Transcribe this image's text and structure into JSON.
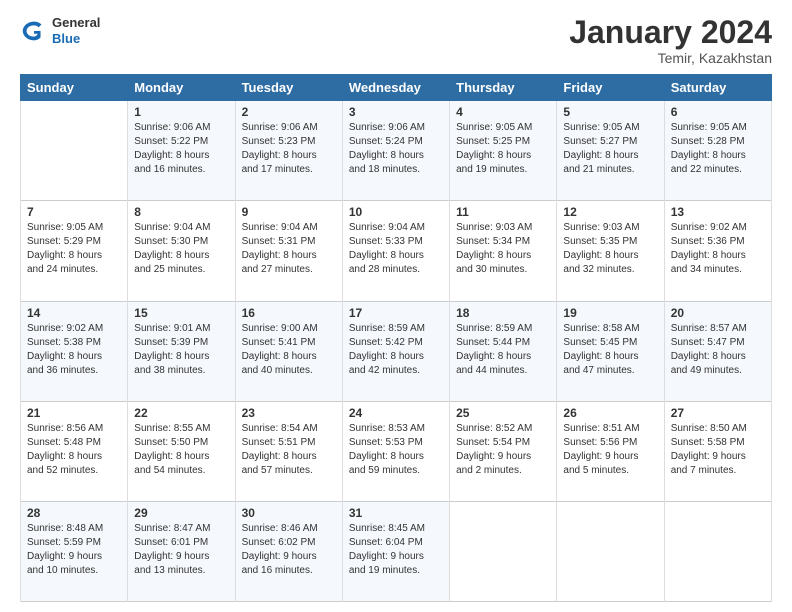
{
  "logo": {
    "general": "General",
    "blue": "Blue"
  },
  "header": {
    "title": "January 2024",
    "subtitle": "Temir, Kazakhstan"
  },
  "columns": [
    "Sunday",
    "Monday",
    "Tuesday",
    "Wednesday",
    "Thursday",
    "Friday",
    "Saturday"
  ],
  "weeks": [
    [
      {
        "day": "",
        "sunrise": "",
        "sunset": "",
        "daylight": ""
      },
      {
        "day": "1",
        "sunrise": "Sunrise: 9:06 AM",
        "sunset": "Sunset: 5:22 PM",
        "daylight": "Daylight: 8 hours and 16 minutes."
      },
      {
        "day": "2",
        "sunrise": "Sunrise: 9:06 AM",
        "sunset": "Sunset: 5:23 PM",
        "daylight": "Daylight: 8 hours and 17 minutes."
      },
      {
        "day": "3",
        "sunrise": "Sunrise: 9:06 AM",
        "sunset": "Sunset: 5:24 PM",
        "daylight": "Daylight: 8 hours and 18 minutes."
      },
      {
        "day": "4",
        "sunrise": "Sunrise: 9:05 AM",
        "sunset": "Sunset: 5:25 PM",
        "daylight": "Daylight: 8 hours and 19 minutes."
      },
      {
        "day": "5",
        "sunrise": "Sunrise: 9:05 AM",
        "sunset": "Sunset: 5:27 PM",
        "daylight": "Daylight: 8 hours and 21 minutes."
      },
      {
        "day": "6",
        "sunrise": "Sunrise: 9:05 AM",
        "sunset": "Sunset: 5:28 PM",
        "daylight": "Daylight: 8 hours and 22 minutes."
      }
    ],
    [
      {
        "day": "7",
        "sunrise": "Sunrise: 9:05 AM",
        "sunset": "Sunset: 5:29 PM",
        "daylight": "Daylight: 8 hours and 24 minutes."
      },
      {
        "day": "8",
        "sunrise": "Sunrise: 9:04 AM",
        "sunset": "Sunset: 5:30 PM",
        "daylight": "Daylight: 8 hours and 25 minutes."
      },
      {
        "day": "9",
        "sunrise": "Sunrise: 9:04 AM",
        "sunset": "Sunset: 5:31 PM",
        "daylight": "Daylight: 8 hours and 27 minutes."
      },
      {
        "day": "10",
        "sunrise": "Sunrise: 9:04 AM",
        "sunset": "Sunset: 5:33 PM",
        "daylight": "Daylight: 8 hours and 28 minutes."
      },
      {
        "day": "11",
        "sunrise": "Sunrise: 9:03 AM",
        "sunset": "Sunset: 5:34 PM",
        "daylight": "Daylight: 8 hours and 30 minutes."
      },
      {
        "day": "12",
        "sunrise": "Sunrise: 9:03 AM",
        "sunset": "Sunset: 5:35 PM",
        "daylight": "Daylight: 8 hours and 32 minutes."
      },
      {
        "day": "13",
        "sunrise": "Sunrise: 9:02 AM",
        "sunset": "Sunset: 5:36 PM",
        "daylight": "Daylight: 8 hours and 34 minutes."
      }
    ],
    [
      {
        "day": "14",
        "sunrise": "Sunrise: 9:02 AM",
        "sunset": "Sunset: 5:38 PM",
        "daylight": "Daylight: 8 hours and 36 minutes."
      },
      {
        "day": "15",
        "sunrise": "Sunrise: 9:01 AM",
        "sunset": "Sunset: 5:39 PM",
        "daylight": "Daylight: 8 hours and 38 minutes."
      },
      {
        "day": "16",
        "sunrise": "Sunrise: 9:00 AM",
        "sunset": "Sunset: 5:41 PM",
        "daylight": "Daylight: 8 hours and 40 minutes."
      },
      {
        "day": "17",
        "sunrise": "Sunrise: 8:59 AM",
        "sunset": "Sunset: 5:42 PM",
        "daylight": "Daylight: 8 hours and 42 minutes."
      },
      {
        "day": "18",
        "sunrise": "Sunrise: 8:59 AM",
        "sunset": "Sunset: 5:44 PM",
        "daylight": "Daylight: 8 hours and 44 minutes."
      },
      {
        "day": "19",
        "sunrise": "Sunrise: 8:58 AM",
        "sunset": "Sunset: 5:45 PM",
        "daylight": "Daylight: 8 hours and 47 minutes."
      },
      {
        "day": "20",
        "sunrise": "Sunrise: 8:57 AM",
        "sunset": "Sunset: 5:47 PM",
        "daylight": "Daylight: 8 hours and 49 minutes."
      }
    ],
    [
      {
        "day": "21",
        "sunrise": "Sunrise: 8:56 AM",
        "sunset": "Sunset: 5:48 PM",
        "daylight": "Daylight: 8 hours and 52 minutes."
      },
      {
        "day": "22",
        "sunrise": "Sunrise: 8:55 AM",
        "sunset": "Sunset: 5:50 PM",
        "daylight": "Daylight: 8 hours and 54 minutes."
      },
      {
        "day": "23",
        "sunrise": "Sunrise: 8:54 AM",
        "sunset": "Sunset: 5:51 PM",
        "daylight": "Daylight: 8 hours and 57 minutes."
      },
      {
        "day": "24",
        "sunrise": "Sunrise: 8:53 AM",
        "sunset": "Sunset: 5:53 PM",
        "daylight": "Daylight: 8 hours and 59 minutes."
      },
      {
        "day": "25",
        "sunrise": "Sunrise: 8:52 AM",
        "sunset": "Sunset: 5:54 PM",
        "daylight": "Daylight: 9 hours and 2 minutes."
      },
      {
        "day": "26",
        "sunrise": "Sunrise: 8:51 AM",
        "sunset": "Sunset: 5:56 PM",
        "daylight": "Daylight: 9 hours and 5 minutes."
      },
      {
        "day": "27",
        "sunrise": "Sunrise: 8:50 AM",
        "sunset": "Sunset: 5:58 PM",
        "daylight": "Daylight: 9 hours and 7 minutes."
      }
    ],
    [
      {
        "day": "28",
        "sunrise": "Sunrise: 8:48 AM",
        "sunset": "Sunset: 5:59 PM",
        "daylight": "Daylight: 9 hours and 10 minutes."
      },
      {
        "day": "29",
        "sunrise": "Sunrise: 8:47 AM",
        "sunset": "Sunset: 6:01 PM",
        "daylight": "Daylight: 9 hours and 13 minutes."
      },
      {
        "day": "30",
        "sunrise": "Sunrise: 8:46 AM",
        "sunset": "Sunset: 6:02 PM",
        "daylight": "Daylight: 9 hours and 16 minutes."
      },
      {
        "day": "31",
        "sunrise": "Sunrise: 8:45 AM",
        "sunset": "Sunset: 6:04 PM",
        "daylight": "Daylight: 9 hours and 19 minutes."
      },
      {
        "day": "",
        "sunrise": "",
        "sunset": "",
        "daylight": ""
      },
      {
        "day": "",
        "sunrise": "",
        "sunset": "",
        "daylight": ""
      },
      {
        "day": "",
        "sunrise": "",
        "sunset": "",
        "daylight": ""
      }
    ]
  ]
}
